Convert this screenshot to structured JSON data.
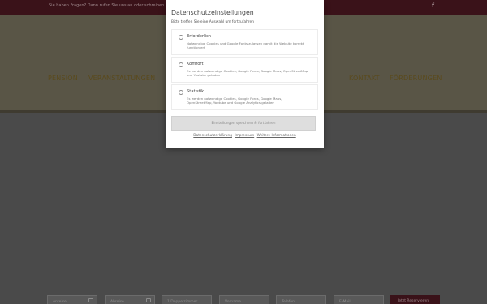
{
  "topbar": {
    "text": "Sie haben Fragen? Dann rufen Sie uns an oder schreiben Sie uns",
    "facebook_glyph": "f"
  },
  "nav": {
    "items": [
      "PENSION",
      "VERANSTALTUNGEN",
      "KONTAKT",
      "FÖRDERUNGEN"
    ]
  },
  "booking": {
    "fields": [
      "Anreise",
      "Abreise",
      "1 Doppelzimmer",
      "Vorname",
      "Telefon",
      "E-Mail"
    ],
    "submit_label": "Jetzt Reservieren"
  },
  "modal": {
    "title": "Datenschutzeinstellungen",
    "subtitle": "Bitte treffen Sie eine Auswahl um fortzufahren",
    "options": [
      {
        "title": "Erforderlich",
        "description": "Notwendige Cookies und Google Fonts zulassen damit die Website korrekt funktioniert"
      },
      {
        "title": "Komfort",
        "description": "Es werden notwendige Cookies, Google Fonts, Google Maps, OpenStreetMap und Youtube geladen"
      },
      {
        "title": "Statistik",
        "description": "Es werden notwendige Cookies, Google Fonts, Google Maps, OpenStreetMap, Youtube und Google Analytics geladen"
      }
    ],
    "save_label": "Einstellungen speichern & fortfahren",
    "links": {
      "privacy": "Datenschutzerklärung",
      "imprint": "Impressum",
      "more": "Weitere Informationen"
    }
  },
  "colors": {
    "topbar": "#3a1219",
    "overlay": "#4a4a4a",
    "modal": "#ffffff"
  }
}
